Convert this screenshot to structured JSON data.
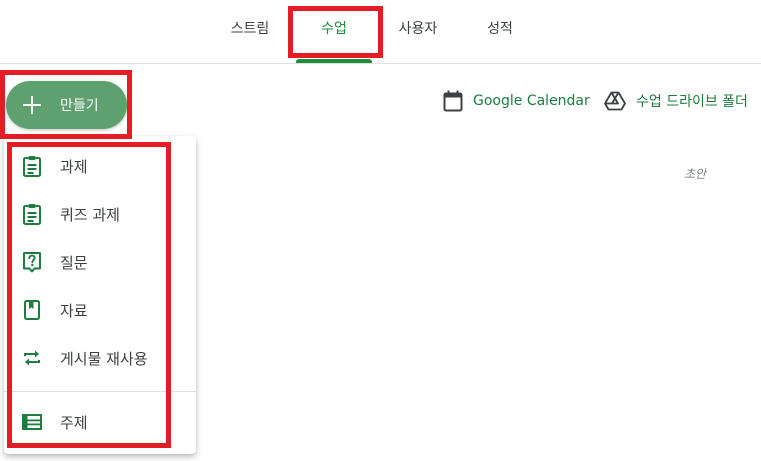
{
  "tabs": [
    {
      "label": "스트림"
    },
    {
      "label": "수업"
    },
    {
      "label": "사용자"
    },
    {
      "label": "성적"
    }
  ],
  "create_button": {
    "label": "만들기"
  },
  "links": {
    "calendar": "Google Calendar",
    "drive": "수업 드라이브 폴더"
  },
  "draft_label": "초안",
  "menu": {
    "items": [
      {
        "label": "과제",
        "icon": "assignment-icon"
      },
      {
        "label": "퀴즈 과제",
        "icon": "quiz-assignment-icon"
      },
      {
        "label": "질문",
        "icon": "question-icon"
      },
      {
        "label": "자료",
        "icon": "material-icon"
      },
      {
        "label": "게시물 재사용",
        "icon": "reuse-post-icon"
      }
    ],
    "topic": {
      "label": "주제",
      "icon": "topic-icon"
    }
  },
  "colors": {
    "accent": "#1e8e3e",
    "button": "#5fa06f",
    "highlight": "#e21d25"
  }
}
